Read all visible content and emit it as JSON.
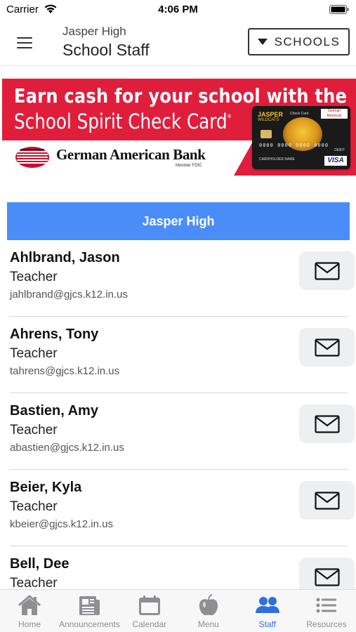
{
  "status_bar": {
    "carrier": "Carrier",
    "time": "4:06 PM"
  },
  "header": {
    "subtitle": "Jasper High",
    "title": "School Staff",
    "schools_button_label": "SCHOOLS"
  },
  "banner": {
    "headline": "Earn cash for your school with the",
    "tagline": "School Spirit Check Card",
    "tagline_mark": "*",
    "bank_name": "German American Bank",
    "bank_fdic": "Member FDIC",
    "card": {
      "school": "JASPER",
      "mascot": "WILDCATS",
      "label": "Check Card",
      "bank_short": "German American",
      "number": "0000 0000 0000 0000",
      "debit": "DEBIT",
      "holder": "CARDHOLDER NAME",
      "network": "VISA"
    }
  },
  "school_bar": {
    "label": "Jasper High",
    "color": "#4a8df8"
  },
  "staff": [
    {
      "name": "Ahlbrand, Jason",
      "role": "Teacher",
      "email": "jahlbrand@gjcs.k12.in.us"
    },
    {
      "name": "Ahrens, Tony",
      "role": "Teacher",
      "email": "tahrens@gjcs.k12.in.us"
    },
    {
      "name": "Bastien, Amy",
      "role": "Teacher",
      "email": "abastien@gjcs.k12.in.us"
    },
    {
      "name": "Beier, Kyla",
      "role": "Teacher",
      "email": "kbeier@gjcs.k12.in.us"
    },
    {
      "name": "Bell, Dee",
      "role": "Teacher",
      "email": ""
    }
  ],
  "tabs": [
    {
      "label": "Home",
      "icon": "home-icon",
      "active": false
    },
    {
      "label": "Announcements",
      "icon": "announcements-icon",
      "active": false
    },
    {
      "label": "Calendar",
      "icon": "calendar-icon",
      "active": false
    },
    {
      "label": "Menu",
      "icon": "apple-icon",
      "active": false
    },
    {
      "label": "Staff",
      "icon": "staff-icon",
      "active": true
    },
    {
      "label": "Resources",
      "icon": "list-icon",
      "active": false
    }
  ],
  "colors": {
    "accent": "#2f6fe0",
    "banner_red": "#e01e3c",
    "tab_inactive": "#8e8e93"
  }
}
